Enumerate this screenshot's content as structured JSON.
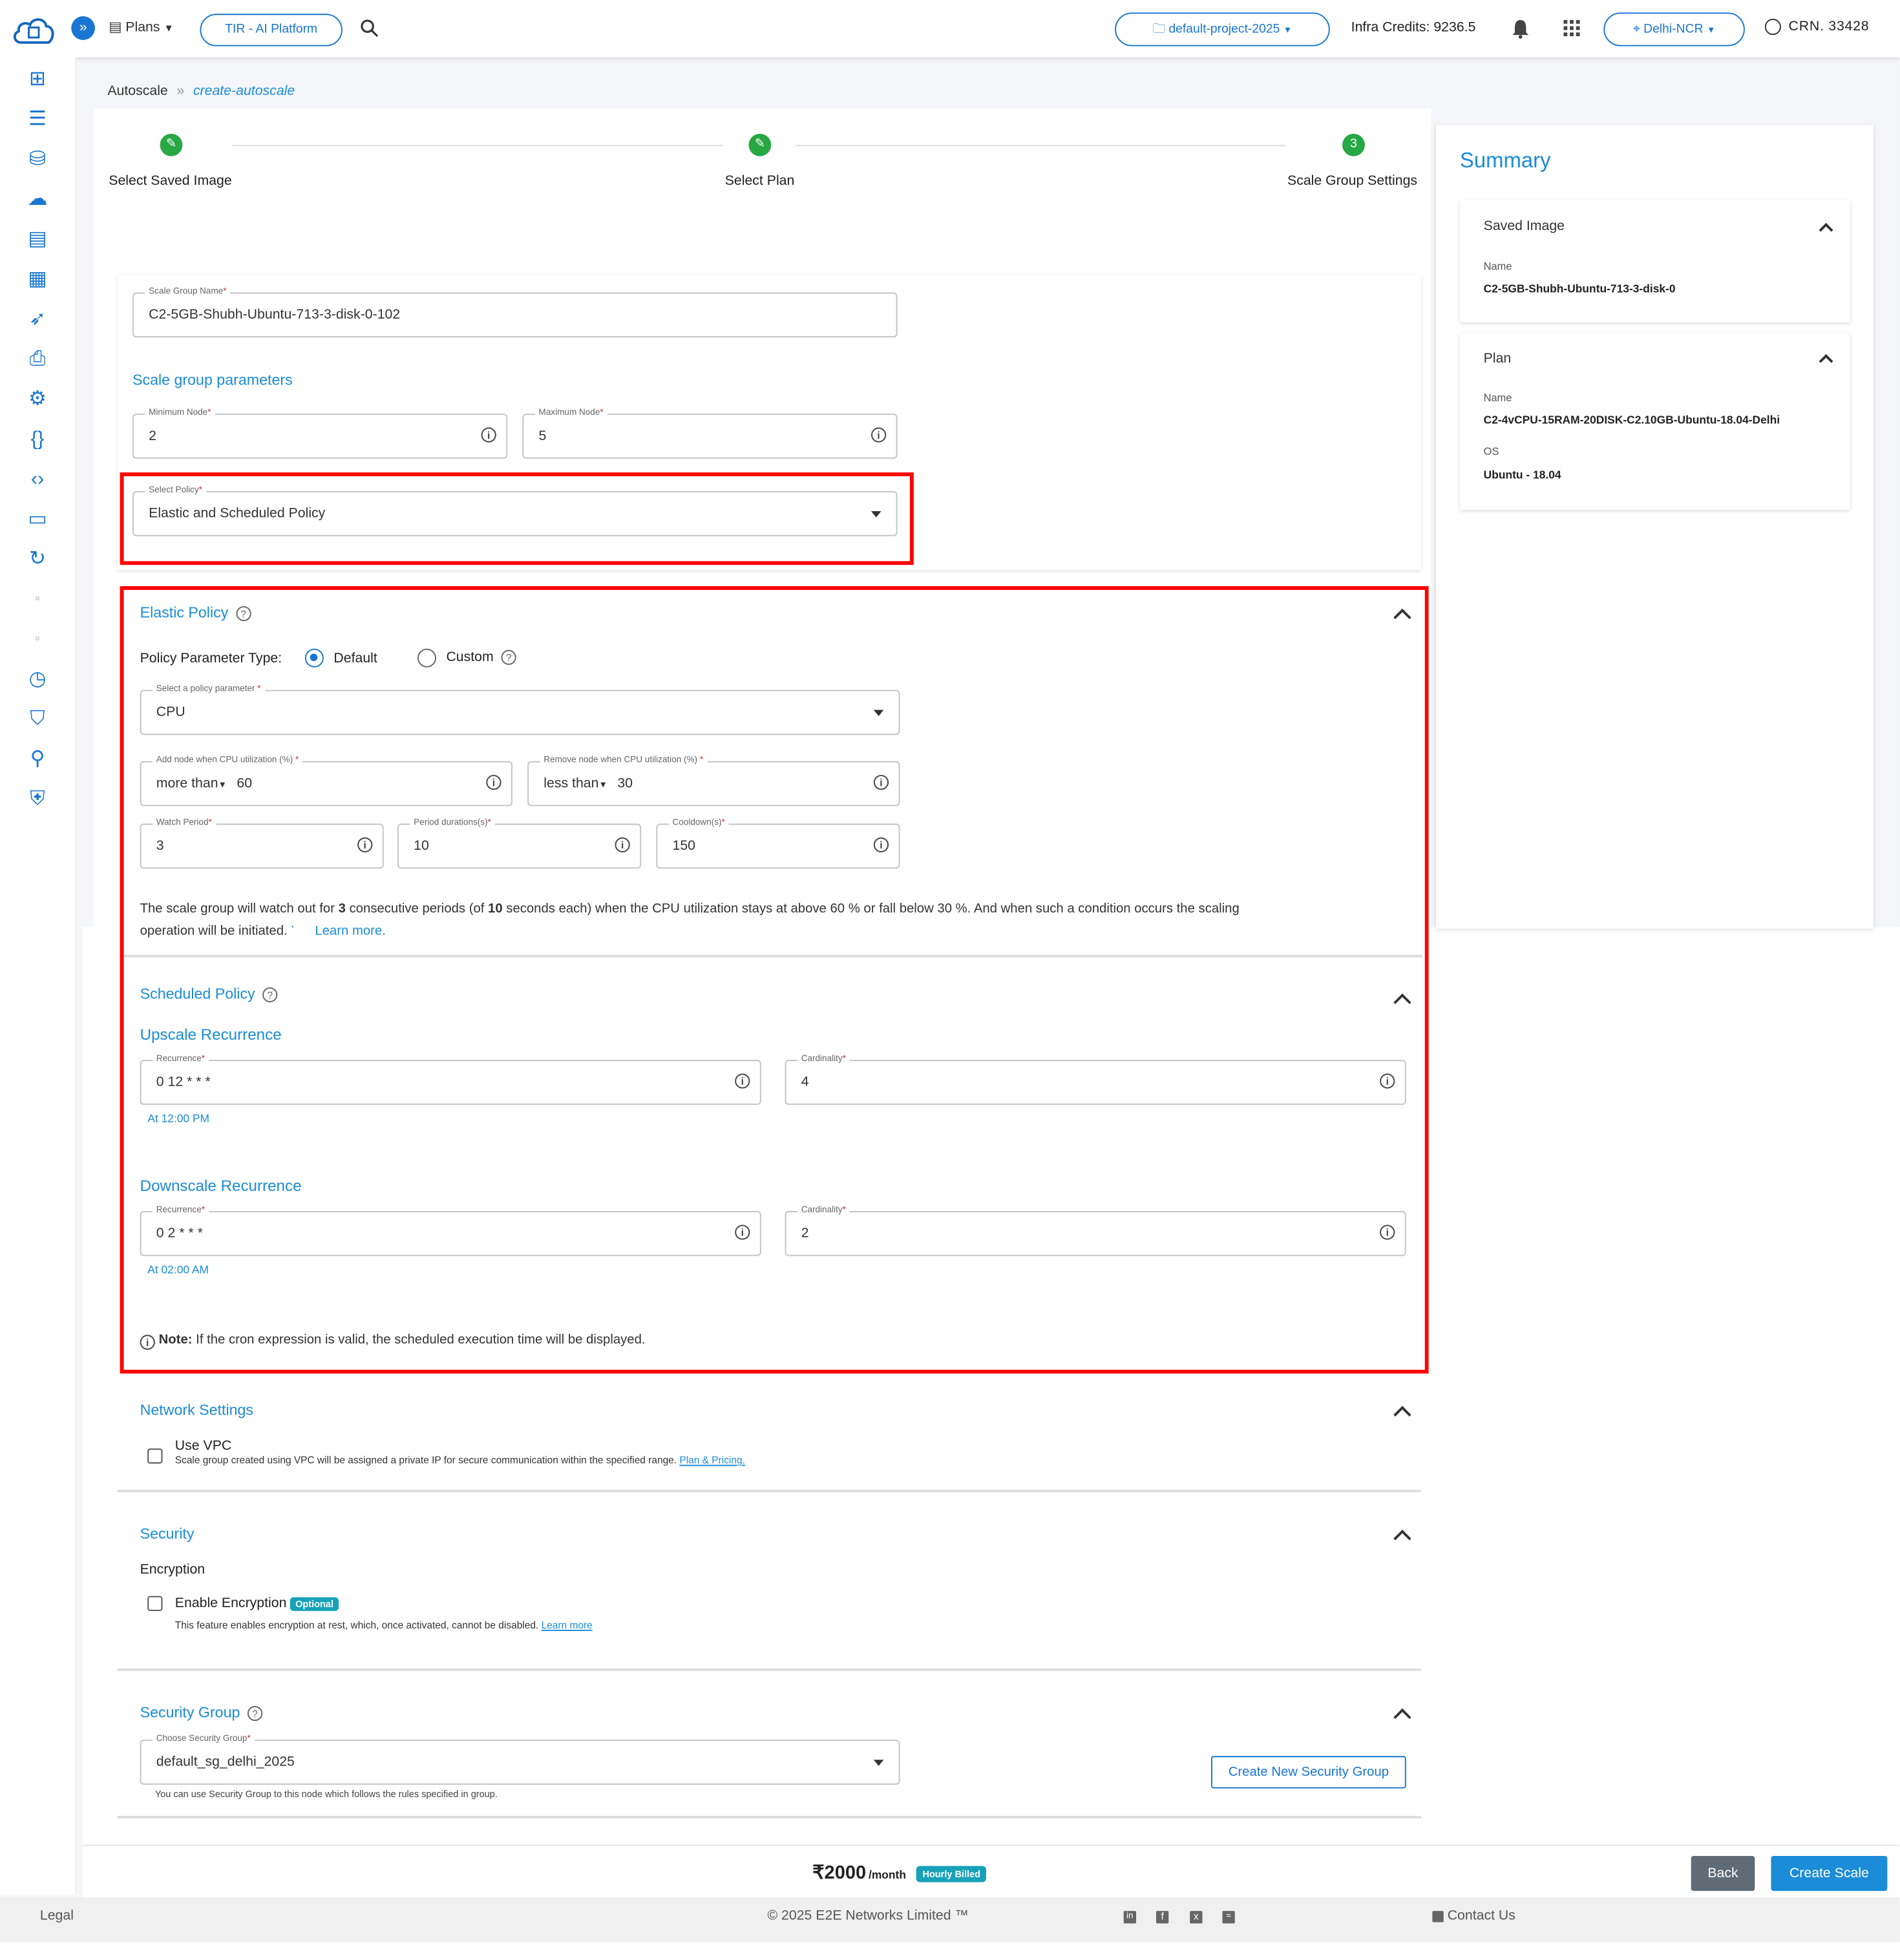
{
  "topbar": {
    "plans_label": "Plans",
    "tir_label": "TIR - AI Platform",
    "project_label": "default-project-2025",
    "infra_credits": "Infra Credits: 9236.5",
    "region_label": "Delhi-NCR",
    "crn_label": "CRN. 33428"
  },
  "breadcrumb": {
    "root": "Autoscale",
    "separator": "»",
    "current": "create-autoscale"
  },
  "steps": [
    {
      "label": "Select Saved Image",
      "state": "done"
    },
    {
      "label": "Select Plan",
      "state": "done"
    },
    {
      "label": "Scale Group Settings",
      "number": "3",
      "state": "active"
    }
  ],
  "form": {
    "scale_group_name_label": "Scale Group Name",
    "scale_group_name": "C2-5GB-Shubh-Ubuntu-713-3-disk-0-102",
    "params_title": "Scale group parameters",
    "min_node_label": "Minimum Node",
    "min_node": "2",
    "max_node_label": "Maximum Node",
    "max_node": "5",
    "policy_label": "Select Policy",
    "policy_value": "Elastic and Scheduled Policy"
  },
  "elastic": {
    "title": "Elastic Policy",
    "param_type_label": "Policy Parameter Type:",
    "option_default": "Default",
    "option_custom": "Custom",
    "policy_param_label": "Select a policy parameter",
    "policy_param_value": "CPU",
    "add_node_label": "Add node when CPU utilization (%)",
    "add_node_cond": "more than",
    "add_node_value": "60",
    "remove_node_label": "Remove node when CPU utilization (%)",
    "remove_node_cond": "less than",
    "remove_node_value": "30",
    "watch_period_label": "Watch Period",
    "watch_period": "3",
    "period_duration_label": "Period durations(s)",
    "period_duration": "10",
    "cooldown_label": "Cooldown(s)",
    "cooldown": "150",
    "desc_1": "The scale group will watch out for ",
    "desc_periods": "3",
    "desc_2": " consecutive periods (of ",
    "desc_secs": "10",
    "desc_3": " seconds each) when the CPU utilization stays at above 60 % or fall below 30 %. And when such a condition occurs the scaling",
    "desc_4": "operation will be initiated. ",
    "learn_more": "Learn more."
  },
  "scheduled": {
    "title": "Scheduled Policy",
    "upscale_title": "Upscale Recurrence",
    "recurrence_label": "Recurrence",
    "cardinality_label": "Cardinality",
    "upscale_recurrence": "0 12 * * *",
    "upscale_cardinality": "4",
    "upscale_time": "At 12:00 PM",
    "downscale_title": "Downscale Recurrence",
    "downscale_recurrence": "0 2 * * *",
    "downscale_cardinality": "2",
    "downscale_time": "At 02:00 AM",
    "note_bold": "Note:",
    "note_text": " If the cron expression is valid, the scheduled execution time will be displayed."
  },
  "network": {
    "title": "Network Settings",
    "vpc_label": "Use VPC",
    "vpc_desc": "Scale group created using VPC will be assigned a private IP for secure communication within the specified range.",
    "vpc_link": "Plan & Pricing."
  },
  "security": {
    "title": "Security",
    "encryption_title": "Encryption",
    "enc_label": "Enable Encryption",
    "enc_badge": "Optional",
    "enc_desc": "This feature enables encryption at rest, which, once activated, cannot be disabled.",
    "enc_link": "Learn more"
  },
  "security_group": {
    "title": "Security Group",
    "choose_label": "Choose Security Group",
    "choose_value": "default_sg_delhi_2025",
    "help_text": "You can use Security Group to this node which follows the rules specified in group.",
    "create_btn": "Create New Security Group"
  },
  "summary": {
    "title": "Summary",
    "saved_image_title": "Saved Image",
    "name_label": "Name",
    "saved_image_name": "C2-5GB-Shubh-Ubuntu-713-3-disk-0",
    "plan_title": "Plan",
    "plan_name": "C2-4vCPU-15RAM-20DISK-C2.10GB-Ubuntu-18.04-Delhi",
    "os_label": "OS",
    "os_value": "Ubuntu - 18.04"
  },
  "bottom": {
    "price": "₹2000",
    "per_month": "/month",
    "billing_badge": "Hourly Billed",
    "back": "Back",
    "create": "Create Scale"
  },
  "footer": {
    "legal": "Legal",
    "copyright": "© 2025 E2E Networks Limited ™",
    "contact": "Contact Us"
  },
  "colors": {
    "accent": "#1976d2",
    "link": "#1a8cd8",
    "success": "#28a745",
    "highlight": "#ff0000",
    "badge": "#17a2b8"
  }
}
